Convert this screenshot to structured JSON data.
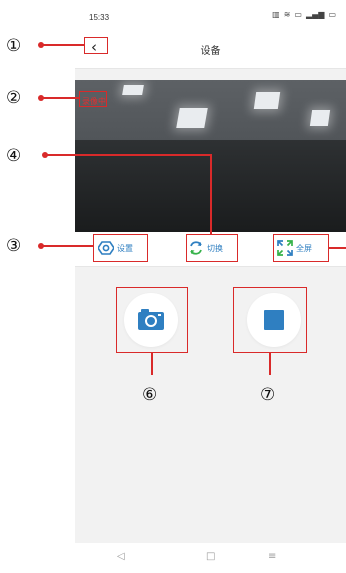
{
  "status_bar": {
    "time": "15:33",
    "icons": [
      "sim-icon",
      "wifi-icon",
      "battery-icon",
      "signal-icon",
      "battery-level-icon"
    ]
  },
  "nav": {
    "title": "设备",
    "back_icon": "chevron-left-icon"
  },
  "video": {
    "recording_badge": "录像中"
  },
  "controls": {
    "settings_label": "设置",
    "switch_label": "切换",
    "fullscreen_label": "全屏"
  },
  "actions": {
    "snapshot_icon": "camera-icon",
    "stop_icon": "stop-icon"
  },
  "bottom_nav": {
    "back": "◁",
    "home": "□",
    "menu": "≡"
  },
  "annotations": {
    "n1": "①",
    "n2": "②",
    "n3": "③",
    "n4": "④",
    "n6": "⑥",
    "n7": "⑦"
  },
  "colors": {
    "accent": "#2f7fc1",
    "annotation": "#d92a2a"
  }
}
